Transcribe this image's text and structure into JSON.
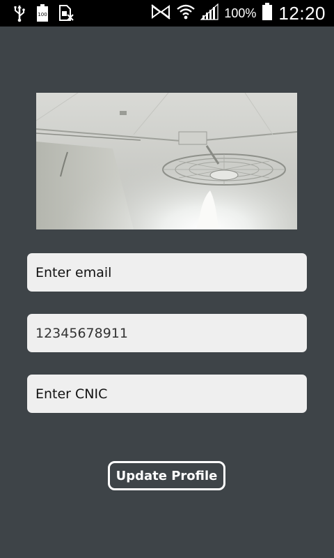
{
  "status_bar": {
    "left_icons": [
      "usb-icon",
      "battery-saver-icon",
      "no-sim-icon"
    ],
    "right_icons": [
      "mute-icon",
      "wifi-icon",
      "signal-icon",
      "battery-icon"
    ],
    "battery_percent": "100%",
    "battery_badge": "100",
    "time": "12:20"
  },
  "profile": {
    "photo_icon": "profile-photo"
  },
  "form": {
    "email_placeholder": "Enter email",
    "phone_value": "12345678911",
    "cnic_placeholder": "Enter CNIC",
    "update_label": "Update Profile"
  },
  "colors": {
    "background": "#3e4448",
    "field": "#efefef",
    "button_border": "#ffffff"
  }
}
